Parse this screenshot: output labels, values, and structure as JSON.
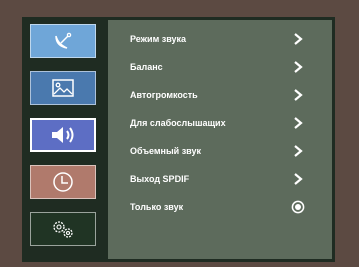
{
  "sidebar": {
    "items": [
      {
        "name": "satellite",
        "icon": "satellite-dish-icon",
        "color": "#6fa6d8",
        "active": false
      },
      {
        "name": "picture",
        "icon": "picture-icon",
        "color": "#4a79ae",
        "active": false
      },
      {
        "name": "sound",
        "icon": "speaker-icon",
        "color": "#5d6ec4",
        "active": true
      },
      {
        "name": "timer",
        "icon": "clock-icon",
        "color": "#b07a6c",
        "active": false
      },
      {
        "name": "settings",
        "icon": "gears-icon",
        "color": "#203424",
        "active": false
      }
    ]
  },
  "menu": {
    "items": [
      {
        "label": "Режим звука",
        "action": "chevron-right-icon"
      },
      {
        "label": "Баланс",
        "action": "chevron-right-icon"
      },
      {
        "label": "Автогромкость",
        "action": "chevron-right-icon"
      },
      {
        "label": "Для слабослышащих",
        "action": "chevron-right-icon"
      },
      {
        "label": "Объемный звук",
        "action": "chevron-right-icon"
      },
      {
        "label": "Выход SPDIF",
        "action": "chevron-right-icon"
      },
      {
        "label": "Только звук",
        "action": "radio-icon"
      }
    ]
  },
  "colors": {
    "background": "#5c4a42",
    "panel": "#5d6b5c",
    "frame": "#1f2c22",
    "text": "#ffffff"
  }
}
